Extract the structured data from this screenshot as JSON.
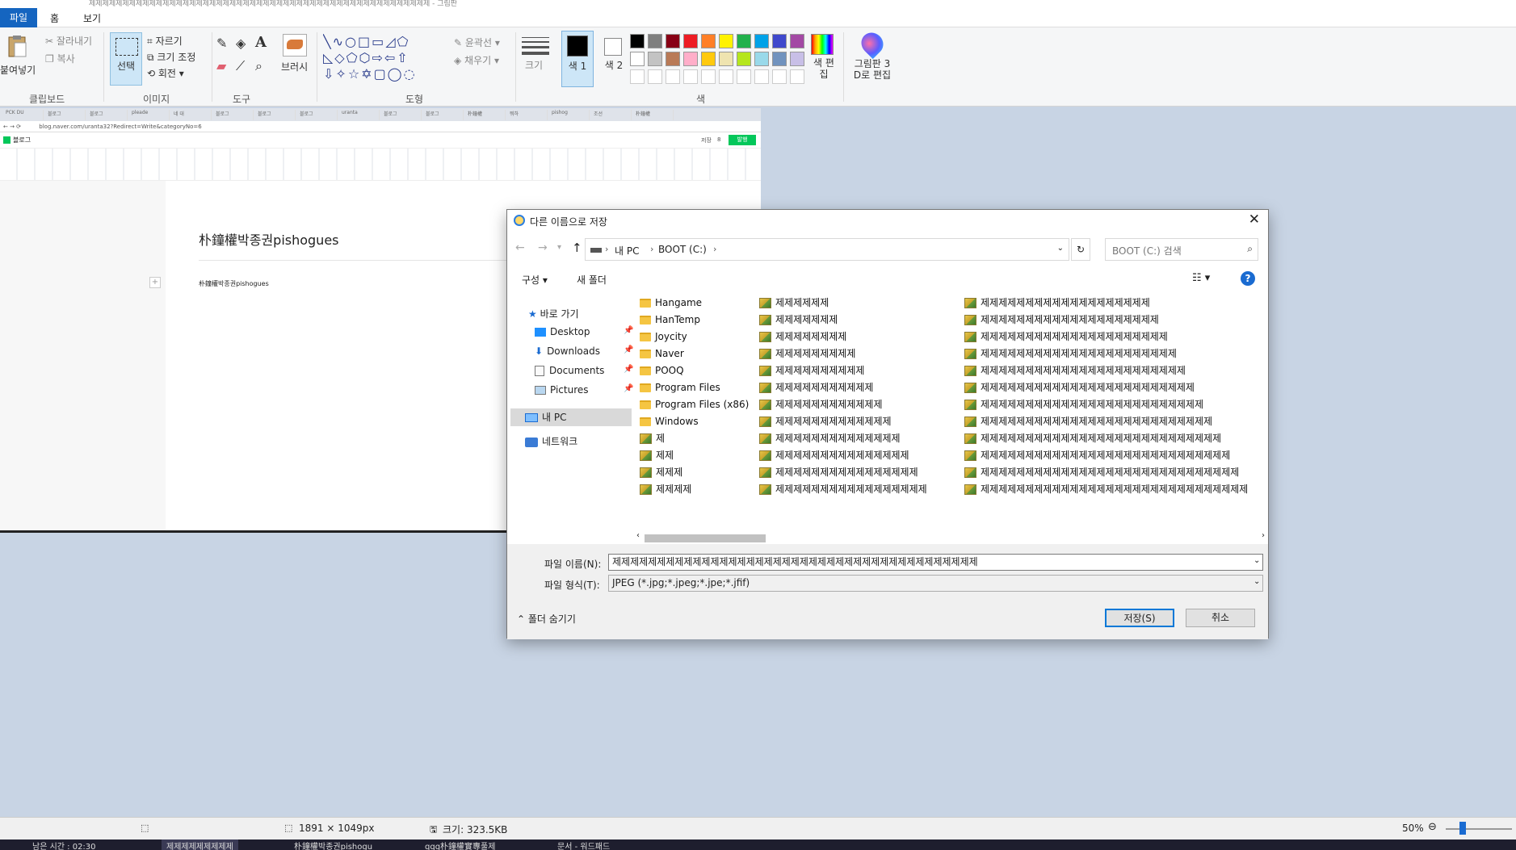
{
  "window": {
    "title": "제제제제제제제제제제제제제제제제제제제제제제제제제제제제제제제제제제제제제제제제제제제제제제제제제제제 - 그림판"
  },
  "menu": {
    "file": "파일",
    "home": "홈",
    "view": "보기"
  },
  "ribbon": {
    "clipboard": {
      "paste": "붙여넣기",
      "cut": "잘라내기",
      "copy": "복사",
      "label": "클립보드"
    },
    "image": {
      "select": "선택",
      "crop": "자르기",
      "resize": "크기 조정",
      "rotate": "회전",
      "label": "이미지"
    },
    "tools": {
      "label": "도구"
    },
    "brushes": {
      "label": "브러시"
    },
    "shapes": {
      "outline": "윤곽선",
      "fill": "채우기",
      "label": "도형"
    },
    "size": {
      "label": "크기"
    },
    "colors": {
      "color1": "색 1",
      "color1_num": "1",
      "color2": "색 2",
      "color2_num": "2",
      "edit": "색 편집",
      "label": "색",
      "row1": [
        "#000000",
        "#7f7f7f",
        "#880015",
        "#ed1c24",
        "#ff7f27",
        "#fff200",
        "#22b14c",
        "#00a2e8",
        "#3f48cc",
        "#a349a4"
      ],
      "row2": [
        "#ffffff",
        "#c3c3c3",
        "#b97a57",
        "#ffaec9",
        "#ffc90e",
        "#efe4b0",
        "#b5e61d",
        "#99d9ea",
        "#7092be",
        "#c8bfe7"
      ]
    },
    "paint3d": {
      "line1": "그림판 3",
      "line2": "D로 편집"
    }
  },
  "inner_browser": {
    "tabs": [
      "PCK DU",
      "블로그",
      "블로그",
      "pleade",
      "네 대",
      "블로그",
      "블로그",
      "블로그",
      "uranta",
      "블로그",
      "블로그",
      "朴鐘權",
      "뭐하",
      "pishog",
      "조선",
      "朴鐘權"
    ],
    "url": "blog.naver.com/uranta32?Redirect=Write&categoryNo=6",
    "blog_label": "블로그",
    "save_label": "저장",
    "save_count": "8",
    "publish": "발행",
    "post_title": "朴鐘權박종권pishogues",
    "post_body": "朴鐘權박종권pishogues"
  },
  "dialog": {
    "title": "다른 이름으로 저장",
    "breadcrumb": [
      "내 PC",
      "BOOT (C:)"
    ],
    "search_placeholder": "BOOT (C:) 검색",
    "organize": "구성",
    "new_folder": "새 폴더",
    "nav": {
      "quick_access": "바로 가기",
      "items": [
        "Desktop",
        "Downloads",
        "Documents",
        "Pictures"
      ],
      "this_pc": "내 PC",
      "network": "네트워크"
    },
    "files_col1": [
      {
        "name": "Hangame",
        "type": "folder"
      },
      {
        "name": "HanTemp",
        "type": "folder"
      },
      {
        "name": "Joycity",
        "type": "folder"
      },
      {
        "name": "Naver",
        "type": "folder"
      },
      {
        "name": "POOQ",
        "type": "folder"
      },
      {
        "name": "Program Files",
        "type": "folder"
      },
      {
        "name": "Program Files (x86)",
        "type": "folder"
      },
      {
        "name": "Windows",
        "type": "folder"
      },
      {
        "name": "제",
        "type": "image"
      },
      {
        "name": "제제",
        "type": "image"
      },
      {
        "name": "제제제",
        "type": "image"
      },
      {
        "name": "제제제제",
        "type": "image"
      },
      {
        "name": "제제제제제",
        "type": "image"
      }
    ],
    "files_col2": [
      "제제제제제제",
      "제제제제제제제",
      "제제제제제제제제",
      "제제제제제제제제제",
      "제제제제제제제제제제",
      "제제제제제제제제제제제",
      "제제제제제제제제제제제제",
      "제제제제제제제제제제제제제",
      "제제제제제제제제제제제제제제",
      "제제제제제제제제제제제제제제제",
      "제제제제제제제제제제제제제제제제",
      "제제제제제제제제제제제제제제제제제",
      "제제제제제제제제제제제제제제제제제제"
    ],
    "files_col3": [
      "제제제제제제제제제제제제제제제제제제제",
      "제제제제제제제제제제제제제제제제제제제제",
      "제제제제제제제제제제제제제제제제제제제제제",
      "제제제제제제제제제제제제제제제제제제제제제제",
      "제제제제제제제제제제제제제제제제제제제제제제제",
      "제제제제제제제제제제제제제제제제제제제제제제제제",
      "제제제제제제제제제제제제제제제제제제제제제제제제제",
      "제제제제제제제제제제제제제제제제제제제제제제제제제제",
      "제제제제제제제제제제제제제제제제제제제제제제제제제제제",
      "제제제제제제제제제제제제제제제제제제제제제제제제제제제제",
      "제제제제제제제제제제제제제제제제제제제제제제제제제제제제제",
      "제제제제제제제제제제제제제제제제제제제제제제제제제제제제제제",
      "제제제제제제제제제제제제제제제제제제제제제제제제제제제제제제제"
    ],
    "filename_label": "파일 이름(N):",
    "filename_value": "제제제제제제제제제제제제제제제제제제제제제제제제제제제제제제제제제제제제제제제제제",
    "filetype_label": "파일 형식(T):",
    "filetype_value": "JPEG (*.jpg;*.jpeg;*.jpe;*.jfif)",
    "hide_folders": "폴더 숨기기",
    "save": "저장(S)",
    "cancel": "취소"
  },
  "status": {
    "dimensions": "1891 × 1049px",
    "size": "크기: 323.5KB",
    "zoom": "50%"
  },
  "taskbar": {
    "items": [
      "남은 시간 : 02:30",
      "제제제제제제제제제",
      "朴鐘權박종권pishogu",
      "qqq朴鐘權實專풀제",
      "문서 - 워드패드"
    ]
  }
}
